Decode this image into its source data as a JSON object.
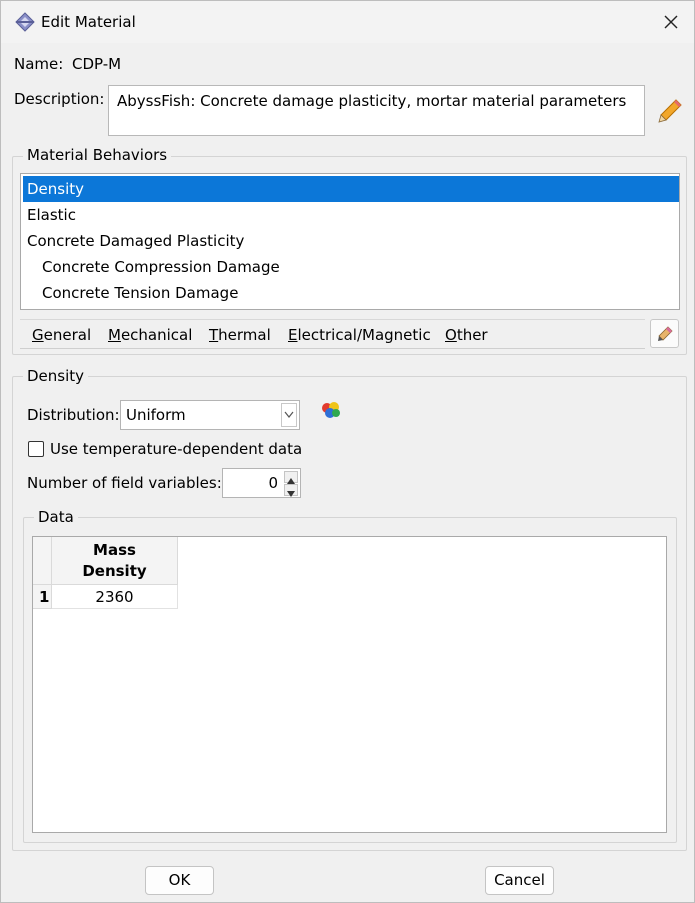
{
  "window": {
    "title": "Edit Material",
    "title_icon": "abaqus-icon",
    "close_icon": "close-icon"
  },
  "name": {
    "label": "Name:",
    "value": "CDP-M"
  },
  "description": {
    "label": "Description:",
    "value": "AbyssFish: Concrete damage plasticity, mortar material parameters",
    "edit_icon": "pencil-icon"
  },
  "behaviors": {
    "group_title": "Material Behaviors",
    "items": [
      {
        "label": "Density",
        "selected": true
      },
      {
        "label": "Elastic"
      },
      {
        "label": "Concrete Damaged Plasticity"
      },
      {
        "label": "Concrete Compression Damage"
      },
      {
        "label": "Concrete Tension Damage"
      }
    ],
    "selected_color": "#0c77d8",
    "menu": [
      {
        "mnemonic": "G",
        "rest": "eneral"
      },
      {
        "mnemonic": "M",
        "rest": "echanical"
      },
      {
        "mnemonic": "T",
        "rest": "hermal"
      },
      {
        "mnemonic": "E",
        "rest": "lectrical/Magnetic"
      },
      {
        "mnemonic": "O",
        "rest": "ther"
      }
    ],
    "menu_edit_icon": "eraser-pencil-icon"
  },
  "density": {
    "group_title": "Density",
    "distribution_label": "Distribution:",
    "distribution_value": "Uniform",
    "distribution_icon": "color-cube-icon",
    "temp_dependent_label": "Use temperature-dependent data",
    "temp_dependent_checked": false,
    "field_vars_label": "Number of field variables:",
    "field_vars_value": "0"
  },
  "data": {
    "group_title": "Data",
    "columns": [
      "Mass\nDensity"
    ],
    "column_line1": "Mass",
    "column_line2": "Density",
    "rows": [
      {
        "index": "1",
        "values": [
          "2360"
        ]
      }
    ]
  },
  "buttons": {
    "ok": "OK",
    "cancel": "Cancel"
  }
}
